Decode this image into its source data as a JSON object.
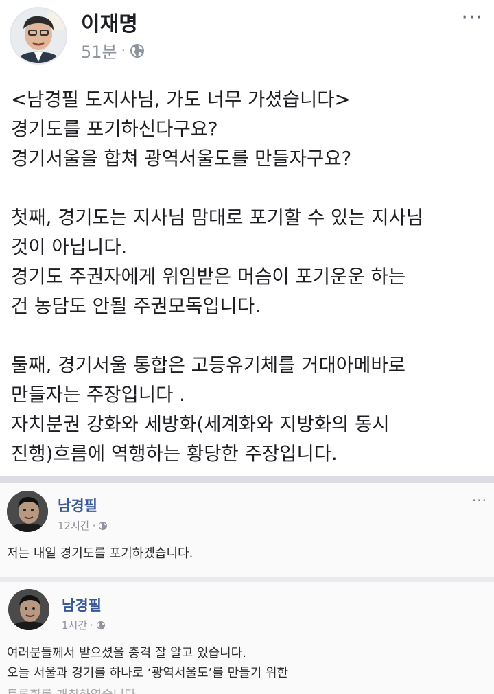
{
  "post": {
    "author": "이재명",
    "time": "51분",
    "separator": "·",
    "privacy_icon": "globe-icon",
    "more_label": "···",
    "lines": [
      "<남경필 도지사님, 가도 너무 가셨습니다>",
      "경기도를 포기하신다구요?",
      "경기서울을 합쳐 광역서울도를 만들자구요?",
      "",
      "첫째, 경기도는 지사님 맘대로 포기할 수 있는 지사님",
      "것이 아닙니다.",
      "경기도 주권자에게 위임받은 머슴이 포기운운 하는",
      "건 농담도 안될 주권모독입니다.",
      "",
      "둘째, 경기서울 통합은 고등유기체를 거대아메바로",
      "만들자는 주장입니다 .",
      "자치분권 강화와 세방화(세계화와 지방화의 동시",
      "진행)흐름에 역행하는 황당한 주장입니다."
    ]
  },
  "shared_posts": [
    {
      "author": "남경필",
      "time": "12시간",
      "separator": "·",
      "more_label": "···",
      "text": [
        "저는 내일 경기도를 포기하겠습니다."
      ]
    },
    {
      "author": "남경필",
      "time": "1시간",
      "separator": "·",
      "text": [
        "여러분들께서 받으셨을 충격 잘 알고 있습니다.",
        "오늘 서울과 경기를 하나로 ‘광역서울도’를 만들기 위한",
        "토론회를 개최하였습니다."
      ]
    }
  ],
  "colors": {
    "name_link": "#385898",
    "meta_gray": "#8d949e",
    "divider": "#dcdde3"
  }
}
